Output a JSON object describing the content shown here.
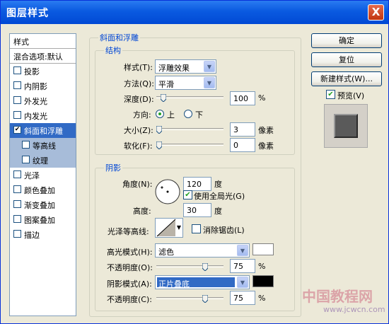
{
  "window": {
    "title": "图层样式",
    "close": "X"
  },
  "sidebar": {
    "items": [
      {
        "label": "样式",
        "checked": false,
        "header": true
      },
      {
        "label": "混合选项:默认",
        "checked": false,
        "header": true
      },
      {
        "label": "投影",
        "checked": false
      },
      {
        "label": "内阴影",
        "checked": false
      },
      {
        "label": "外发光",
        "checked": false
      },
      {
        "label": "内发光",
        "checked": false
      },
      {
        "label": "斜面和浮雕",
        "checked": true,
        "selected": true
      },
      {
        "label": "等高线",
        "checked": false,
        "sub": true
      },
      {
        "label": "纹理",
        "checked": false,
        "sub": true
      },
      {
        "label": "光泽",
        "checked": false
      },
      {
        "label": "颜色叠加",
        "checked": false
      },
      {
        "label": "渐变叠加",
        "checked": false
      },
      {
        "label": "图案叠加",
        "checked": false
      },
      {
        "label": "描边",
        "checked": false
      }
    ]
  },
  "bevel": {
    "group_title": "斜面和浮雕",
    "structure": {
      "title": "结构",
      "style_label": "样式(T):",
      "style_value": "浮雕效果",
      "technique_label": "方法(Q):",
      "technique_value": "平滑",
      "depth_label": "深度(D):",
      "depth_value": "100",
      "depth_unit": "%",
      "depth_pos": 0.07,
      "direction_label": "方向:",
      "direction_up": "上",
      "direction_down": "下",
      "size_label": "大小(Z):",
      "size_value": "3",
      "size_unit": "像素",
      "size_pos": 0.0,
      "soften_label": "软化(F):",
      "soften_value": "0",
      "soften_unit": "像素",
      "soften_pos": 0.0
    },
    "shading": {
      "title": "阴影",
      "angle_label": "角度(N):",
      "angle_value": "120",
      "angle_unit": "度",
      "global_light_label": "使用全局光(G)",
      "global_light_checked": true,
      "altitude_label": "高度:",
      "altitude_value": "30",
      "altitude_unit": "度",
      "gloss_label": "光泽等高线:",
      "antialias_label": "消除锯齿(L)",
      "antialias_checked": false,
      "highlight_mode_label": "高光模式(H):",
      "highlight_mode_value": "滤色",
      "highlight_color": "#ffffff",
      "highlight_opacity_label": "不透明度(O):",
      "highlight_opacity_value": "75",
      "highlight_opacity_unit": "%",
      "highlight_opacity_pos": 0.75,
      "shadow_mode_label": "阴影模式(A):",
      "shadow_mode_value": "正片叠底",
      "shadow_color": "#000000",
      "shadow_opacity_label": "不透明度(C):",
      "shadow_opacity_value": "75",
      "shadow_opacity_unit": "%",
      "shadow_opacity_pos": 0.75
    }
  },
  "buttons": {
    "ok": "确定",
    "reset": "复位",
    "new_style": "新建样式(W)...",
    "preview": "预览(V)",
    "preview_checked": true
  },
  "watermark": {
    "line1": "中国教程网",
    "line2": "www.jcwcn.com"
  }
}
